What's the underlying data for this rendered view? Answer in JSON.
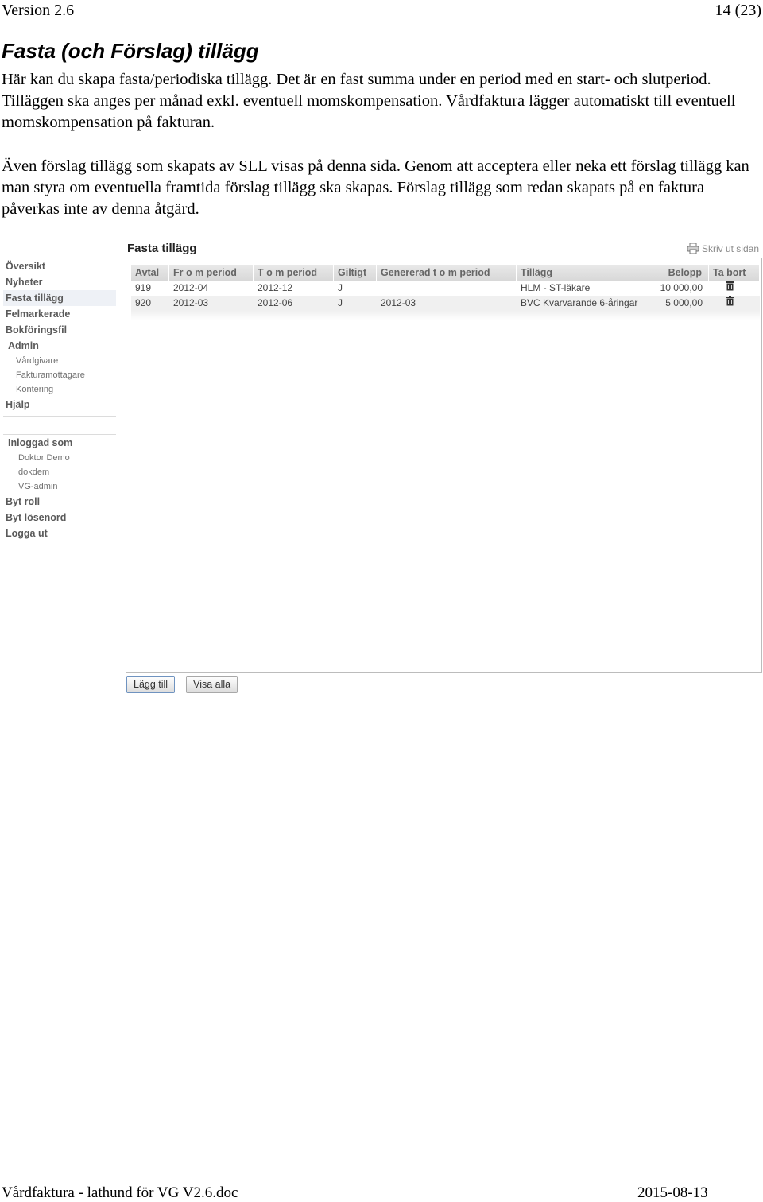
{
  "header": {
    "version": "Version 2.6",
    "page": "14 (23)"
  },
  "section_title": "Fasta (och Förslag) tillägg",
  "paragraphs": [
    "Här kan du skapa fasta/periodiska tillägg. Det är en fast summa under en period med en start- och slutperiod. Tilläggen ska anges per månad exkl. eventuell momskompensation. Vårdfaktura lägger automatiskt till eventuell momskompensation på fakturan.",
    "Även förslag tillägg som skapats av SLL visas på denna sida. Genom att acceptera eller neka ett förslag tillägg kan man styra om eventuella framtida förslag tillägg ska skapas. Förslag tillägg som redan skapats på en faktura påverkas inte av denna åtgärd."
  ],
  "app": {
    "panel_title": "Fasta tillägg",
    "print_link": "Skriv ut sidan",
    "nav": [
      "Översikt",
      "Nyheter",
      "Fasta tillägg",
      "Felmarkerade",
      "Bokföringsfil",
      "Admin",
      "Vårdgivare",
      "Fakturamottagare",
      "Kontering",
      "Hjälp",
      "Inloggad som",
      "Doktor Demo",
      "dokdem",
      "VG-admin",
      "Byt roll",
      "Byt lösenord",
      "Logga ut"
    ],
    "table": {
      "headers": [
        "Avtal",
        "Fr o m period",
        "T o m period",
        "Giltigt",
        "Genererad t o m period",
        "Tillägg",
        "Belopp",
        "Ta bort"
      ],
      "rows": [
        [
          "919",
          "2012-04",
          "2012-12",
          "J",
          "",
          "HLM - ST-läkare",
          "10 000,00"
        ],
        [
          "920",
          "2012-03",
          "2012-06",
          "J",
          "2012-03",
          "BVC Kvarvarande 6-åringar",
          "5 000,00"
        ]
      ]
    },
    "buttons": {
      "add": "Lägg till",
      "show_all": "Visa alla"
    },
    "icons": {
      "print": "printer-icon",
      "delete": "trash-icon"
    }
  },
  "footer": {
    "doc": "Vårdfaktura - lathund för VG V2.6.doc",
    "date": "2015-08-13"
  }
}
